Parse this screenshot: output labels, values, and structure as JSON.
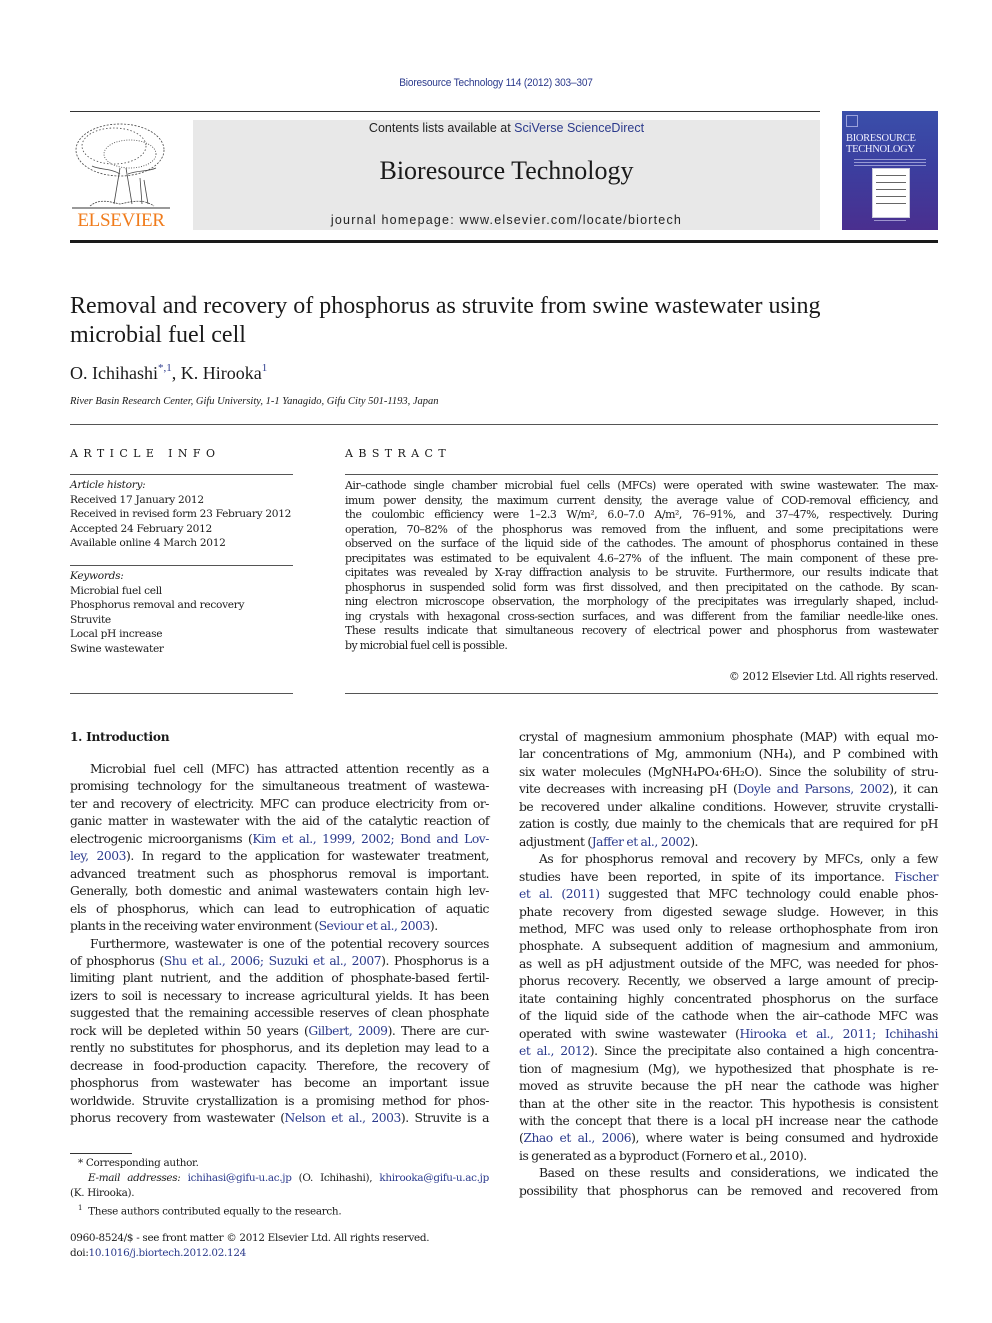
{
  "running_head": "Bioresource Technology 114 (2012) 303–307",
  "masthead": {
    "publisher_logo_text": "ELSEVIER",
    "contents_prefix": "Contents lists available at ",
    "contents_link": "SciVerse ScienceDirect",
    "journal_title": "Bioresource Technology",
    "homepage": "journal homepage: www.elsevier.com/locate/biortech",
    "cover_title_line1": "BIORESOURCE",
    "cover_title_line2": "TECHNOLOGY"
  },
  "colors": {
    "link": "#2b3a8c",
    "elsevier_orange": "#f07c1c",
    "masthead_bg": "#e8e8e8",
    "cover_blue": "#3b3fa0"
  },
  "article": {
    "title_line1": "Removal and recovery of phosphorus as struvite from swine wastewater using",
    "title_line2": "microbial fuel cell",
    "authors": [
      {
        "name": "O. Ichihashi",
        "marks": "*,1"
      },
      {
        "name": "K. Hirooka",
        "marks": "1"
      }
    ],
    "author_separator": ", ",
    "affiliation": "River Basin Research Center, Gifu University, 1-1 Yanagido, Gifu City 501-1193, Japan"
  },
  "article_info": {
    "heading": "ARTICLE INFO",
    "history_label": "Article history:",
    "history": [
      "Received 17 January 2012",
      "Received in revised form 23 February 2012",
      "Accepted 24 February 2012",
      "Available online 4 March 2012"
    ],
    "keywords_label": "Keywords:",
    "keywords": [
      "Microbial fuel cell",
      "Phosphorus removal and recovery",
      "Struvite",
      "Local pH increase",
      "Swine wastewater"
    ]
  },
  "abstract": {
    "heading": "ABSTRACT",
    "lines": [
      "Air–cathode single chamber microbial fuel cells (MFCs) were operated with swine wastewater. The max-",
      "imum power density, the maximum current density, the average value of COD-removal efficiency, and",
      "the coulombic efficiency were 1–2.3 W/m², 6.0–7.0 A/m², 76–91%, and 37–47%, respectively. During",
      "operation, 70–82% of the phosphorus was removed from the influent, and some precipitations were",
      "observed on the surface of the liquid side of the cathodes. The amount of phosphorus contained in these",
      "precipitates was estimated to be equivalent 4.6–27% of the influent. The main component of these pre-",
      "cipitates was revealed by X-ray diffraction analysis to be struvite. Furthermore, our results indicate that",
      "phosphorus in suspended solid form was first dissolved, and then precipitated on the cathode. By scan-",
      "ning electron microscope observation, the morphology of the precipitates was irregularly shaped, includ-",
      "ing crystals with hexagonal cross-section surfaces, and was different from the familiar needle-like ones.",
      "These results indicate that simultaneous recovery of electrical power and phosphorus from wastewater",
      "by microbial fuel cell is possible."
    ],
    "copyright": "© 2012 Elsevier Ltd. All rights reserved."
  },
  "introduction": {
    "heading": "1. Introduction",
    "left_lines": [
      {
        "t": "Microbial fuel cell (MFC) has attracted attention recently as a",
        "indent": true
      },
      {
        "t": "promising technology for the simultaneous treatment of wastewa-"
      },
      {
        "t": "ter and recovery of electricity. MFC can produce electricity from or-"
      },
      {
        "t": "ganic matter in wastewater with the aid of the catalytic reaction of"
      },
      {
        "t": "electrogenic microorganisms (",
        "link": "Kim et al., 1999, 2002; Bond and Lov-",
        "after": ""
      },
      {
        "pre": "",
        "link": "ley, 2003",
        "after": "). In regard to the application for wastewater treatment,"
      },
      {
        "t": "advanced treatment such as phosphorus removal is important."
      },
      {
        "t": "Generally, both domestic and animal wastewaters contain high lev-"
      },
      {
        "t": "els of phosphorus, which can lead to eutrophication of aquatic"
      },
      {
        "pre": "plants in the receiving water environment (",
        "link": "Seviour et al., 2003",
        "after": ").",
        "last": true
      },
      {
        "t": "Furthermore, wastewater is one of the potential recovery sources",
        "indent": true
      },
      {
        "pre": "of phosphorus (",
        "link": "Shu et al., 2006; Suzuki et al., 2007",
        "after": "). Phosphorus is a"
      },
      {
        "t": "limiting plant nutrient, and the addition of phosphate-based fertil-"
      },
      {
        "t": "izers to soil is necessary to increase agricultural yields. It has been"
      },
      {
        "t": "suggested that the remaining accessible reserves of clean phosphate"
      },
      {
        "pre": "rock will be depleted within 50 years (",
        "link": "Gilbert, 2009",
        "after": "). There are cur-"
      },
      {
        "t": "rently no substitutes for phosphorus, and its depletion may lead to a"
      },
      {
        "t": "decrease in food-production capacity. Therefore, the recovery of"
      },
      {
        "t": "phosphorus from wastewater has become an important issue"
      },
      {
        "t": "worldwide. Struvite crystallization is a promising method for phos-"
      },
      {
        "pre": "phorus recovery from wastewater (",
        "link": "Nelson et al., 2003",
        "after": "). Struvite is a"
      }
    ],
    "right_lines": [
      {
        "t": "crystal of magnesium ammonium phosphate (MAP) with equal mo-"
      },
      {
        "t": "lar concentrations of Mg, ammonium (NH₄), and P combined with"
      },
      {
        "t": "six water molecules (MgNH₄PO₄·6H₂O). Since the solubility of stru-"
      },
      {
        "pre": "vite decreases with increasing pH (",
        "link": "Doyle and Parsons, 2002",
        "after": "), it can"
      },
      {
        "t": "be recovered under alkaline conditions. However, struvite crystalli-"
      },
      {
        "t": "zation is costly, due mainly to the chemicals that are required for pH"
      },
      {
        "pre": "adjustment (",
        "link": "Jaffer et al., 2002",
        "after": ").",
        "last": true
      },
      {
        "t": "As for phosphorus removal and recovery by MFCs, only a few",
        "indent": true
      },
      {
        "pre": "studies have been reported, in spite of its importance. ",
        "link": "Fischer",
        "after": ""
      },
      {
        "pre": "",
        "link": "et al. (2011)",
        "after": " suggested that MFC technology could enable phos-"
      },
      {
        "t": "phate recovery from digested sewage sludge. However, in this"
      },
      {
        "t": "method, MFC was used only to release orthophosphate from iron"
      },
      {
        "t": "phosphate. A subsequent addition of magnesium and ammonium,"
      },
      {
        "t": "as well as pH adjustment outside of the MFC, was needed for phos-"
      },
      {
        "t": "phorus recovery. Recently, we observed a large amount of precip-"
      },
      {
        "t": "itate containing highly concentrated phosphorus on the surface"
      },
      {
        "t": "of the liquid side of the cathode when the air–cathode MFC was"
      },
      {
        "pre": "operated with swine wastewater (",
        "link": "Hirooka et al., 2011; Ichihashi",
        "after": ""
      },
      {
        "pre": "",
        "link": "et al., 2012",
        "after": "). Since the precipitate also contained a high concentra-"
      },
      {
        "t": "tion of magnesium (Mg), we hypothesized that phosphate is re-"
      },
      {
        "t": "moved as struvite because the pH near the cathode was higher"
      },
      {
        "t": "than at the other site in the reactor. This hypothesis is consistent"
      },
      {
        "t": "with the concept that there is a local pH increase near the cathode"
      },
      {
        "pre": "(",
        "link": "Zhao et al., 2006",
        "after": "), where water is being consumed and hydroxide"
      },
      {
        "t": "is generated as a byproduct (Fornero et al., 2010).",
        "last": true
      },
      {
        "t": "Based on these results and considerations, we indicated the",
        "indent": true
      },
      {
        "t": "possibility that phosphorus can be removed and recovered from"
      }
    ]
  },
  "footnotes": {
    "corresponding": "* Corresponding author.",
    "email_label": "E-mail addresses:",
    "email1": "ichihasi@gifu-u.ac.jp",
    "email1_owner": "(O. Ichihashi),",
    "email2": "khirooka@gifu-u.ac.jp",
    "email2_owner": "(K. Hirooka).",
    "equal_contrib_mark": "1",
    "equal_contrib": "These authors contributed equally to the research."
  },
  "front_matter": {
    "issn_line": "0960-8524/$ - see front matter © 2012 Elsevier Ltd. All rights reserved.",
    "doi_label": "doi:",
    "doi": "10.1016/j.biortech.2012.02.124"
  }
}
